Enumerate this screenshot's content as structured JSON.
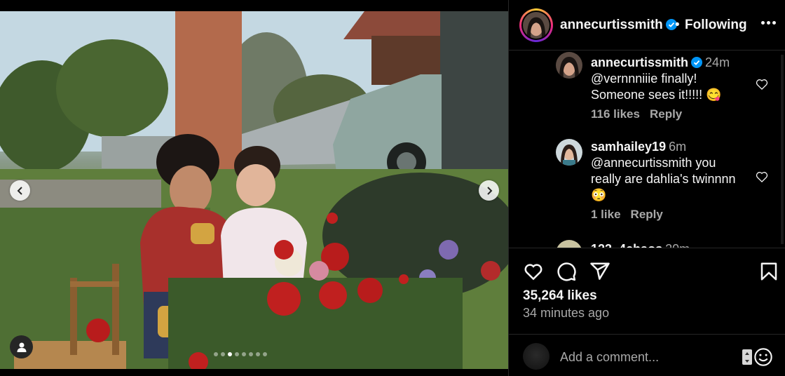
{
  "post": {
    "username": "annecurtissmith",
    "separator": "•",
    "follow_status": "Following",
    "carousel": {
      "total_slides": 8,
      "active_index": 2
    }
  },
  "comments": [
    {
      "username": "annecurtissmith",
      "verified": true,
      "time": "24m",
      "text_line1": "@vernnniiie finally!",
      "text_line2": "Someone sees it!!!!! 😋",
      "likes": "116 likes",
      "reply": "Reply"
    },
    {
      "username": "samhailey19",
      "verified": false,
      "time": "6m",
      "text_line1": "@annecurtissmith you",
      "text_line2": "really are dahlia's twinnnn",
      "text_line3": "😳",
      "likes": "1 like",
      "reply": "Reply"
    },
    {
      "username_partial": "123_4chaos",
      "time_partial": "20m"
    }
  ],
  "actions": {
    "like_icon": "heart-icon",
    "comment_icon": "comment-icon",
    "share_icon": "send-icon",
    "save_icon": "bookmark-icon"
  },
  "stats": {
    "likes": "35,264 likes",
    "posted": "34 minutes ago"
  },
  "composer": {
    "placeholder": "Add a comment...",
    "emoji_icon": "smiley-icon"
  },
  "colors": {
    "background": "#000000",
    "text_primary": "#f5f5f5",
    "text_secondary": "#a8a8a8",
    "verified_blue": "#0095f6",
    "divider": "#262626"
  }
}
